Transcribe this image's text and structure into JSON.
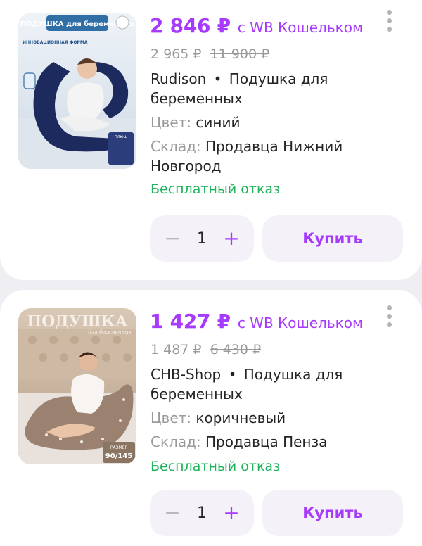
{
  "products": [
    {
      "image_label": "ПОДУШКА для беременных",
      "image_sublabel": "ИННОВАЦИОННАЯ ФОРМА",
      "image_badge": "плюш",
      "price": "2 846 ₽",
      "wallet_label": "с WB Кошельком",
      "old_price": "2 965 ₽",
      "strike_price": "11 900 ₽",
      "brand": "Rudison",
      "separator": "•",
      "name": "Подушка для беременных",
      "color_key": "Цвет:",
      "color_value": "синий",
      "stock_key": "Склад:",
      "stock_value": "Продавца Нижний Новгород",
      "free_return": "Бесплатный отказ",
      "quantity": "1",
      "buy_label": "Купить"
    },
    {
      "image_label": "ПОДУШКА",
      "image_sublabel": "для беременных",
      "image_badge_line1": "РАЗМЕР",
      "image_badge_line2": "90/145",
      "price": "1 427 ₽",
      "wallet_label": "с WB Кошельком",
      "old_price": "1 487 ₽",
      "strike_price": "6 430 ₽",
      "brand": "CHB-Shop",
      "separator": "•",
      "name": "Подушка для беременных",
      "color_key": "Цвет:",
      "color_value": "коричневый",
      "stock_key": "Склад:",
      "stock_value": "Продавца Пенза",
      "free_return": "Бесплатный отказ",
      "quantity": "1",
      "buy_label": "Купить"
    }
  ],
  "icons": {
    "minus": "−",
    "plus": "+"
  },
  "colors": {
    "accent": "#a73afd",
    "success": "#1fb45b",
    "muted": "#9a9a9a",
    "button_bg": "#f4f2f8",
    "background": "#efeef3"
  }
}
